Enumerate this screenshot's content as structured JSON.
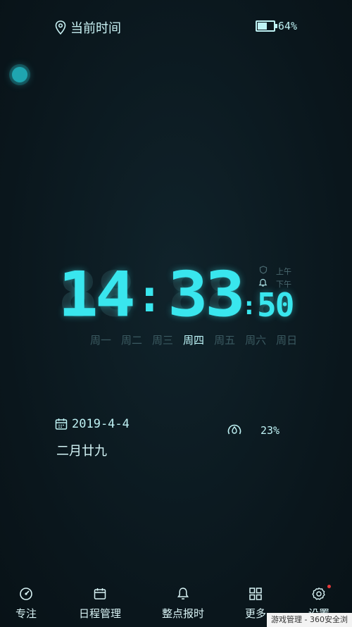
{
  "header": {
    "location_label": "当前时间",
    "battery_percent": "64%",
    "battery_level": 0.64
  },
  "clock": {
    "hour_tens": "1",
    "hour_ones": "4",
    "minute_tens": "3",
    "minute_ones": "3",
    "seconds": "50",
    "am_label": "上午",
    "pm_label": "下午"
  },
  "weekdays": [
    "周一",
    "周二",
    "周三",
    "周四",
    "周五",
    "周六",
    "周日"
  ],
  "active_weekday": 3,
  "date": {
    "gregorian": "2019-4-4",
    "lunar": "二月廿九"
  },
  "humidity": {
    "value": "23%"
  },
  "nav": {
    "items": [
      {
        "label": "专注",
        "icon": "focus-dial-icon"
      },
      {
        "label": "日程管理",
        "icon": "calendar-icon"
      },
      {
        "label": "整点报时",
        "icon": "bell-icon"
      },
      {
        "label": "更多",
        "icon": "grid-icon"
      },
      {
        "label": "设置",
        "icon": "gear-icon"
      }
    ]
  },
  "watermark": "游戏管理 - 360安全浏",
  "colors": {
    "accent": "#39e6ee",
    "background": "#0c1a21",
    "notice_dot": "#e43b3b"
  }
}
